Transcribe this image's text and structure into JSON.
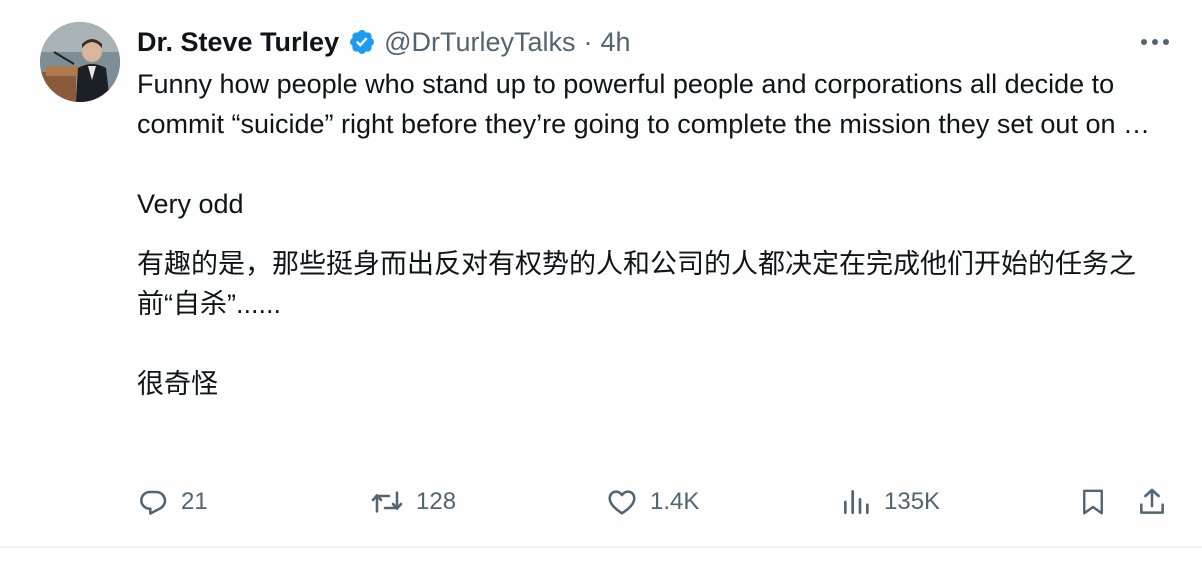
{
  "author": {
    "display_name": "Dr. Steve Turley",
    "handle": "@DrTurleyTalks",
    "separator": "·",
    "time": "4h"
  },
  "tweet": {
    "p1": "Funny how people who stand up to powerful people and corporations all decide to commit “suicide” right before they’re going to complete the mission they set out on …",
    "p2": "Very odd",
    "p3": "有趣的是，那些挺身而出反对有权势的人和公司的人都决定在完成他们开始的任务之前“自杀”......",
    "p4": "很奇怪"
  },
  "actions": {
    "replies": "21",
    "reposts": "128",
    "likes": "1.4K",
    "views": "135K"
  },
  "icons": {
    "verified": "verified-badge-icon",
    "more": "more-icon",
    "reply": "reply-icon",
    "repost": "repost-icon",
    "like": "heart-icon",
    "views": "views-icon",
    "bookmark": "bookmark-icon",
    "share": "share-icon"
  },
  "colors": {
    "verified_blue": "#1d9bf0",
    "text": "#0f1419",
    "secondary": "#536471"
  }
}
